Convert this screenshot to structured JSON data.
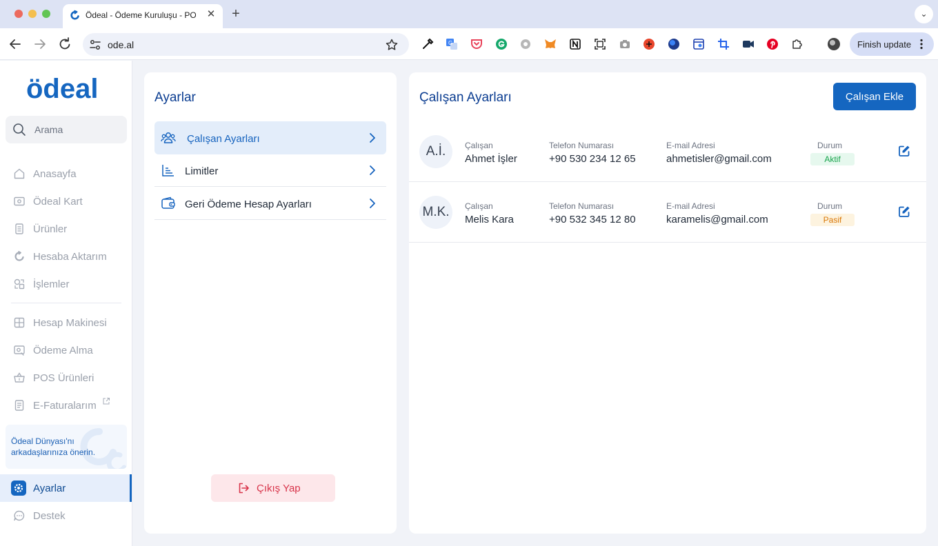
{
  "browser": {
    "tab_title": "Ödeal - Ödeme Kuruluşu - POS",
    "url": "ode.al",
    "finish_update_label": "Finish update"
  },
  "sidebar": {
    "logo_text": "ödeal",
    "search_placeholder": "Arama",
    "items": [
      {
        "label": "Anasayfa",
        "icon": "home-icon"
      },
      {
        "label": "Ödeal Kart",
        "icon": "card-icon"
      },
      {
        "label": "Ürünler",
        "icon": "products-icon"
      },
      {
        "label": "Hesaba Aktarım",
        "icon": "transfer-icon"
      },
      {
        "label": "İşlemler",
        "icon": "transactions-icon"
      },
      {
        "label": "Hesap Makinesi",
        "icon": "calculator-icon"
      },
      {
        "label": "Ödeme Alma",
        "icon": "payment-icon"
      },
      {
        "label": "POS Ürünleri",
        "icon": "basket-icon"
      },
      {
        "label": "E-Faturalarım",
        "icon": "invoice-icon"
      }
    ],
    "promo_text": "Ödeal Dünyası'nı arkadaşlarınıza önerin.",
    "active_item": {
      "label": "Ayarlar",
      "icon": "settings-icon"
    },
    "support_item": {
      "label": "Destek",
      "icon": "chat-icon"
    }
  },
  "settings": {
    "title": "Ayarlar",
    "menu": [
      {
        "label": "Çalışan Ayarları",
        "icon": "users-icon",
        "active": true
      },
      {
        "label": "Limitler",
        "icon": "chart-icon",
        "active": false
      },
      {
        "label": "Geri Ödeme Hesap Ayarları",
        "icon": "wallet-icon",
        "active": false
      }
    ],
    "logout_label": "Çıkış Yap"
  },
  "employees": {
    "title": "Çalışan Ayarları",
    "add_button_label": "Çalışan Ekle",
    "column_labels": {
      "employee": "Çalışan",
      "phone": "Telefon Numarası",
      "email": "E-mail Adresi",
      "status": "Durum"
    },
    "rows": [
      {
        "initials": "A.İ.",
        "name": "Ahmet İşler",
        "phone": "+90 530 234 12 65",
        "email": "ahmetisler@gmail.com",
        "status": "Aktif"
      },
      {
        "initials": "M.K.",
        "name": "Melis Kara",
        "phone": "+90 532 345 12 80",
        "email": "karamelis@gmail.com",
        "status": "Pasif"
      }
    ]
  },
  "colors": {
    "primary": "#1566c0",
    "title": "#0b3d91",
    "active_bg": "#e3edfa",
    "logout_bg": "#fde7ea",
    "logout_text": "#d8344a",
    "status_active": "#16a34a",
    "status_passive": "#d97706"
  }
}
